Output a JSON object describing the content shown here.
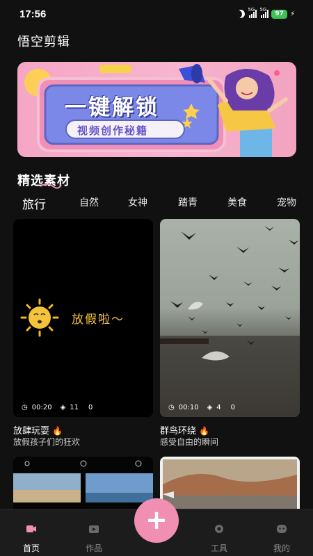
{
  "status": {
    "time": "17:56",
    "sig1": "5G",
    "sig2": "5G",
    "battery": "97"
  },
  "app": {
    "title": "悟空剪辑"
  },
  "banner": {
    "headline": "一键解锁",
    "subline": "视频创作秘籍"
  },
  "section": {
    "title": "精选素材"
  },
  "tabs": [
    "旅行",
    "自然",
    "女神",
    "踏青",
    "美食",
    "宠物"
  ],
  "cards": [
    {
      "overlay_text": "放假啦～",
      "duration": "00:20",
      "layers": "11",
      "count": "0",
      "title": "放肆玩耍",
      "subtitle": "放假孩子们的狂欢"
    },
    {
      "duration": "00:10",
      "layers": "4",
      "count": "0",
      "title": "群鸟环绕",
      "subtitle": "感受自由的瞬间"
    }
  ],
  "nav": {
    "home": "首页",
    "works": "作品",
    "tools": "工具",
    "mine": "我的"
  },
  "colors": {
    "accent": "#f08fb1",
    "background": "#111111",
    "battery": "#3cc255"
  }
}
